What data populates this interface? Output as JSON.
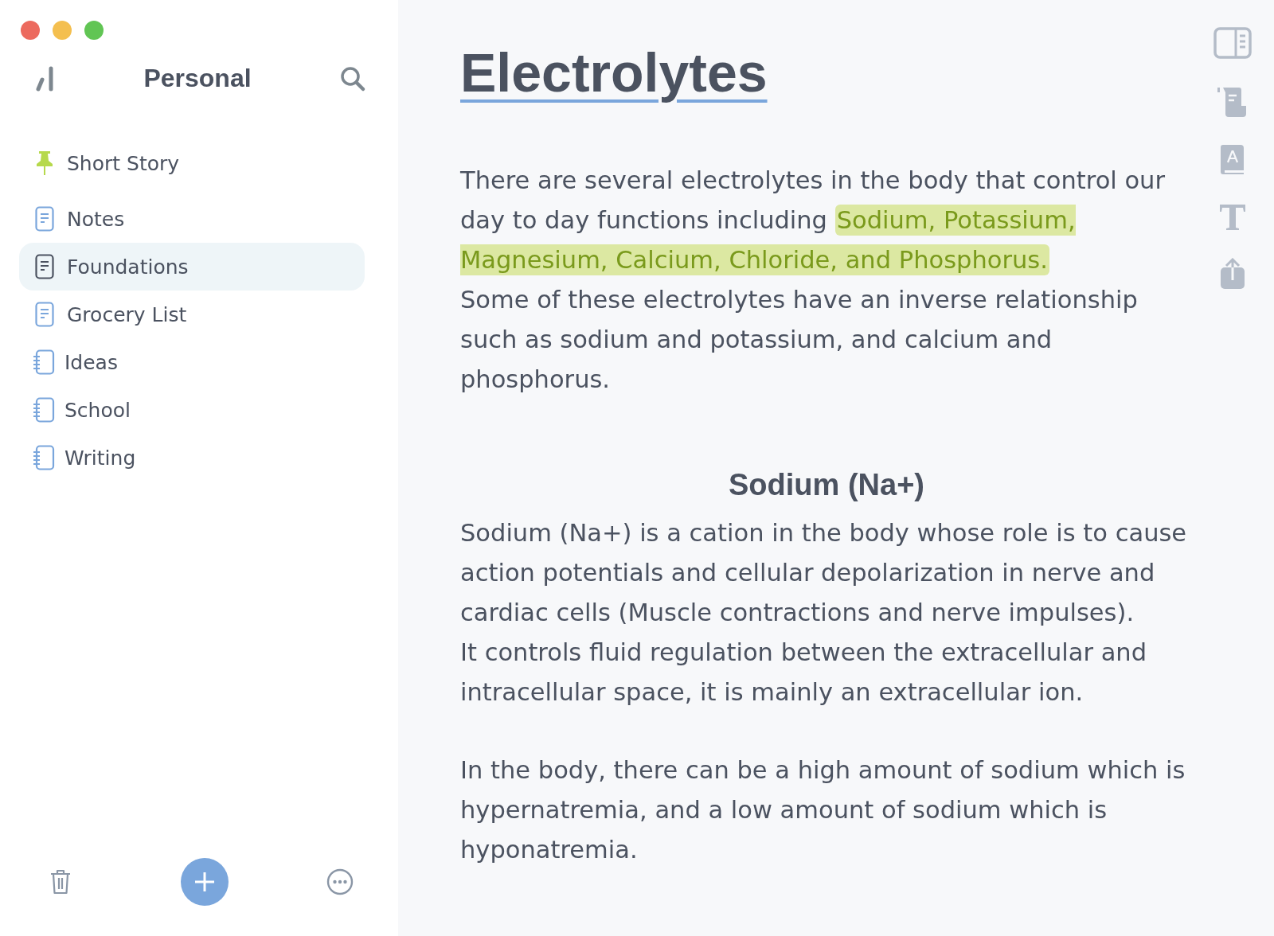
{
  "sidebar": {
    "title": "Personal",
    "items": [
      {
        "label": "Short Story",
        "kind": "pinned",
        "selected": false
      },
      {
        "label": "Notes",
        "kind": "note",
        "selected": false
      },
      {
        "label": "Foundations",
        "kind": "note",
        "selected": true
      },
      {
        "label": "Grocery List",
        "kind": "note",
        "selected": false
      },
      {
        "label": "Ideas",
        "kind": "notebook",
        "selected": false
      },
      {
        "label": "School",
        "kind": "notebook",
        "selected": false
      },
      {
        "label": "Writing",
        "kind": "notebook",
        "selected": false
      }
    ]
  },
  "document": {
    "title": "Electrolytes",
    "blocks": [
      {
        "kind": "paragraph",
        "segments": [
          {
            "text": "There are several electrolytes in the body that control our day to day functions including ",
            "highlighted": false
          },
          {
            "text": "Sodium, Potassium, Magnesium, Calcium, Chloride, and Phosphorus.",
            "highlighted": true
          }
        ]
      },
      {
        "kind": "line",
        "segments": [
          {
            "text": "Some of these electrolytes have an inverse relationship such as sodium and potassium, and calcium and phosphorus.",
            "highlighted": false
          }
        ]
      },
      {
        "kind": "heading",
        "segments": [
          {
            "text": "Sodium (Na+)",
            "highlighted": false
          }
        ]
      },
      {
        "kind": "line",
        "segments": [
          {
            "text": "Sodium (Na+) is a cation in the body whose role is to cause action potentials and cellular depolarization in nerve and cardiac cells (Muscle contractions and nerve impulses).",
            "highlighted": false
          }
        ]
      },
      {
        "kind": "line",
        "segments": [
          {
            "text": "It controls fluid regulation between the extracellular and intracellular space, it is mainly an extracellular ion.",
            "highlighted": false
          }
        ]
      },
      {
        "kind": "paragraph",
        "segments": [
          {
            "text": "In the body, there can be a high amount of sodium which is hypernatremia, and a low amount of sodium which is hyponatremia.",
            "highlighted": false
          }
        ]
      }
    ]
  }
}
